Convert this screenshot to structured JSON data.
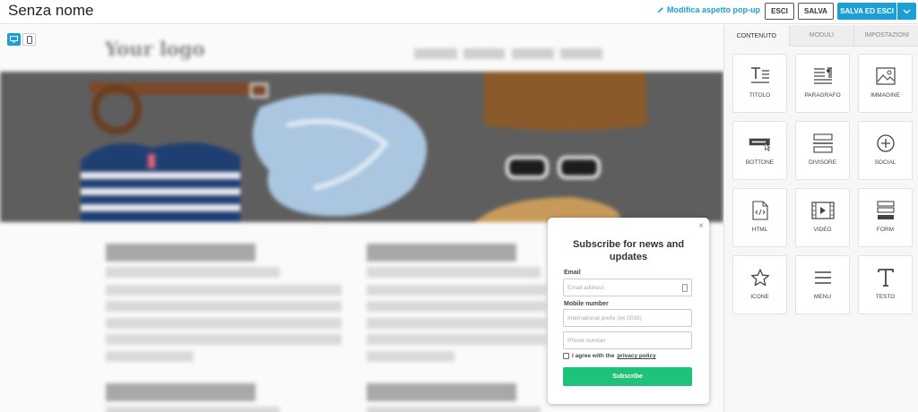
{
  "header": {
    "title": "Senza nome",
    "edit_link": "Modifica aspetto pop-up",
    "btn_exit": "ESCI",
    "btn_save": "SALVA",
    "btn_save_exit": "SALVA ED ESCI"
  },
  "canvas": {
    "logo": "Your logo"
  },
  "popup": {
    "close": "×",
    "title": "Subscribe for news and updates",
    "email_label": "Email",
    "email_placeholder": "Email address",
    "mobile_label": "Mobile number",
    "prefix_placeholder": "International prefix (ex 0039)",
    "phone_placeholder": "Phone number",
    "agree_text": "I agree with the",
    "privacy_link": "privacy policy",
    "submit": "Subscribe"
  },
  "panel": {
    "tabs": [
      "CONTENUTO",
      "MODULI",
      "IMPOSTAZIONI"
    ],
    "tiles": [
      {
        "label": "TITOLO",
        "icon": "title-icon"
      },
      {
        "label": "PARAGRAFO",
        "icon": "paragraph-icon"
      },
      {
        "label": "IMMAGINE",
        "icon": "image-icon"
      },
      {
        "label": "BOTTONE",
        "icon": "button-icon"
      },
      {
        "label": "DIVISORE",
        "icon": "divider-icon"
      },
      {
        "label": "SOCIAL",
        "icon": "social-icon"
      },
      {
        "label": "HTML",
        "icon": "html-icon"
      },
      {
        "label": "VIDEO",
        "icon": "video-icon"
      },
      {
        "label": "FORM",
        "icon": "form-icon"
      },
      {
        "label": "ICONE",
        "icon": "star-icon"
      },
      {
        "label": "MENU",
        "icon": "menu-icon"
      },
      {
        "label": "TESTO",
        "icon": "text-icon"
      }
    ]
  },
  "colors": {
    "accent": "#1c9fd6",
    "submit": "#1ec278"
  }
}
